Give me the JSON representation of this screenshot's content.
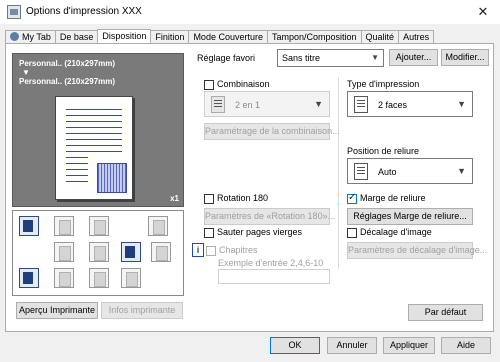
{
  "window": {
    "title": "Options d'impression XXX",
    "close_glyph": "✕"
  },
  "tabs": [
    {
      "label": "My Tab"
    },
    {
      "label": "De base"
    },
    {
      "label": "Disposition"
    },
    {
      "label": "Finition"
    },
    {
      "label": "Mode Couverture"
    },
    {
      "label": "Tampon/Composition"
    },
    {
      "label": "Qualité"
    },
    {
      "label": "Autres"
    }
  ],
  "active_tab": "Disposition",
  "preview": {
    "line1": "Personnal.. (210x297mm)",
    "arrow": "▼",
    "line2": "Personnal.. (210x297mm)",
    "copies": "x1"
  },
  "bottom_left_buttons": {
    "printer_preview": "Aperçu Imprimante",
    "printer_info": "Infos imprimante"
  },
  "favorite": {
    "label": "Réglage favori",
    "value": "Sans titre",
    "add": "Ajouter...",
    "modify": "Modifier..."
  },
  "combination": {
    "label": "Combinaison",
    "checked": false,
    "value": "2 en 1",
    "settings_button": "Paramétrage de la combinaison..."
  },
  "print_type": {
    "label": "Type d'impression",
    "value": "2 faces"
  },
  "binding_position": {
    "label": "Position de reliure",
    "value": "Auto"
  },
  "rotation": {
    "label": "Rotation 180",
    "checked": false,
    "settings_button": "Paramètres de «Rotation 180»..."
  },
  "skip_blank": {
    "label": "Sauter pages vierges",
    "checked": false
  },
  "chapters": {
    "label": "Chapitres",
    "example": "Exemple d'entrée 2,4,6-10",
    "value": ""
  },
  "binding_margin": {
    "label": "Marge de reliure",
    "checked": true,
    "settings_button": "Réglages Marge de reliure..."
  },
  "image_shift": {
    "label": "Décalage d'image",
    "checked": false,
    "settings_button": "Paramètres de décalage d'image..."
  },
  "default_button": "Par défaut",
  "footer": {
    "ok": "OK",
    "cancel": "Annuler",
    "apply": "Appliquer",
    "help": "Aide"
  },
  "icons": {
    "app": "printer-options-icon",
    "info": "info-icon",
    "grid": [
      "combination-layout-icon",
      "image-layout-icon",
      "copy-layout-icon",
      "rotation-layout-icon",
      "booklet-icon",
      "text-layout-icon",
      "page-layout-icon",
      "chapter-layout-icon",
      "cover-icon",
      "staple-layout-icon",
      "punch-layout-icon",
      "fold-layout-icon"
    ]
  },
  "colors": {
    "accent_blue": "#0078d7",
    "preview_bg": "#7a7a7a",
    "page_lines": "#3d4a9e"
  }
}
